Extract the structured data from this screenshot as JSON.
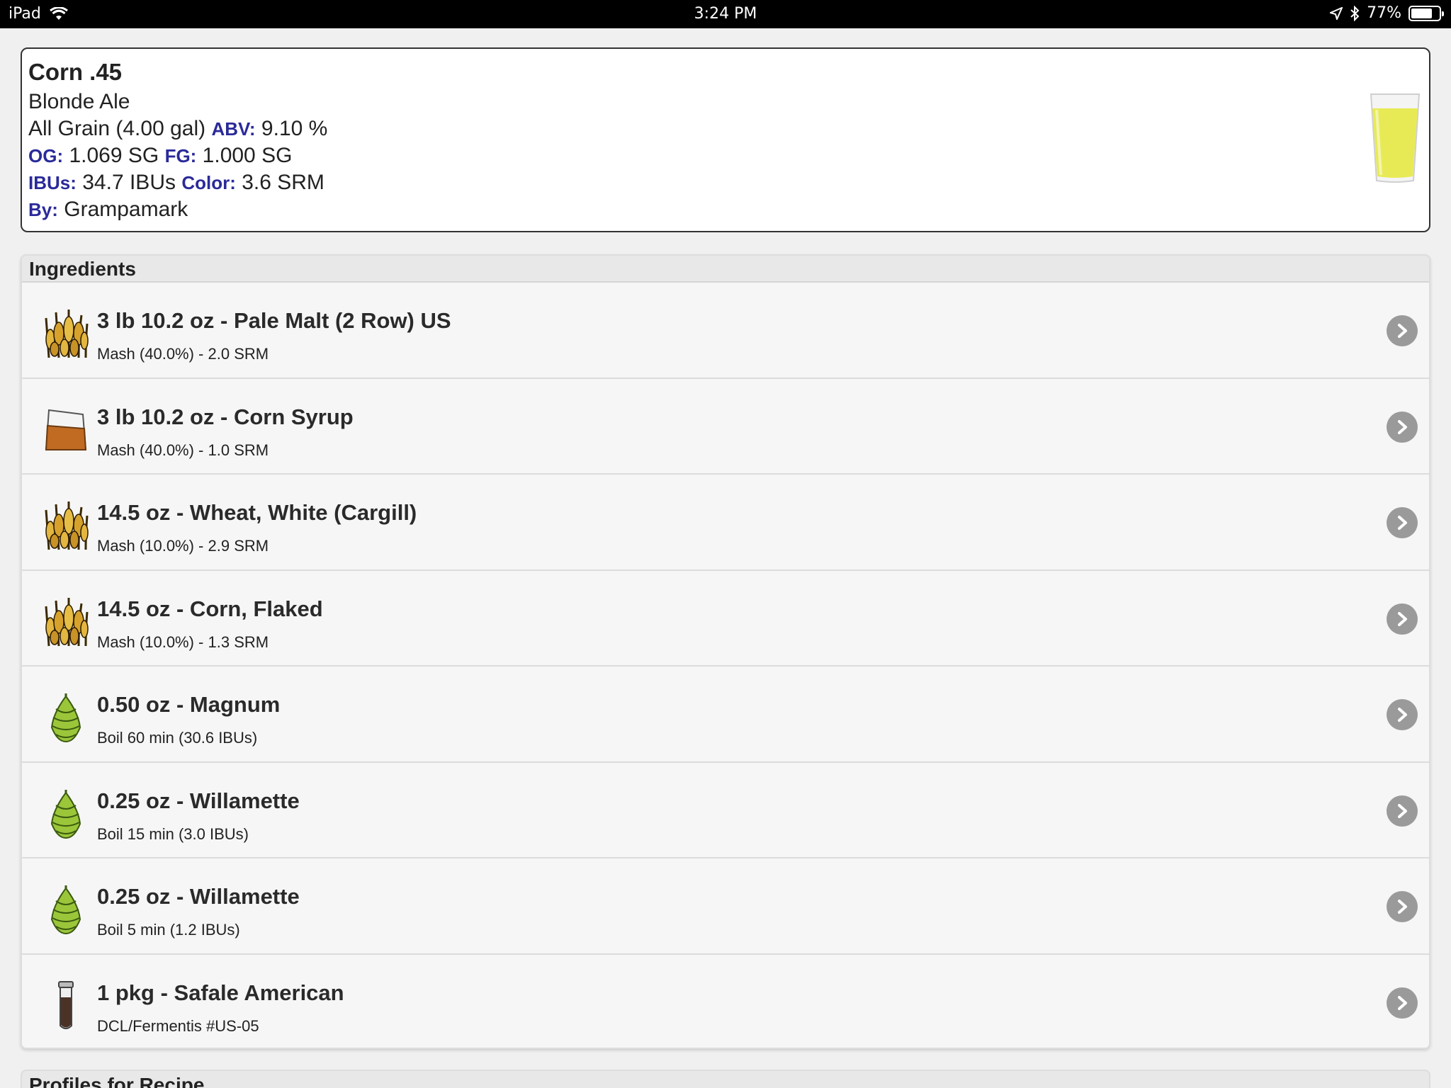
{
  "status_bar": {
    "device": "iPad",
    "time": "3:24 PM",
    "battery": "77%",
    "battery_level": 0.77
  },
  "recipe": {
    "name": "Corn .45",
    "style": "Blonde Ale",
    "type": "All Grain (4.00 gal)",
    "abv_label": "ABV:",
    "abv": "9.10 %",
    "og_label": "OG:",
    "og": "1.069 SG",
    "fg_label": "FG:",
    "fg": "1.000 SG",
    "ibus_label": "IBUs:",
    "ibus": "34.7 IBUs",
    "color_label": "Color:",
    "color": "3.6 SRM",
    "by_label": "By:",
    "by": "Grampamark",
    "glass_color": "#e8ea55"
  },
  "ingredients": {
    "header": "Ingredients",
    "items": [
      {
        "icon": "grain-icon",
        "name": "3 lb 10.2 oz - Pale Malt (2 Row) US",
        "detail": "Mash (40.0%) - 2.0 SRM"
      },
      {
        "icon": "syrup-icon",
        "name": "3 lb 10.2 oz - Corn Syrup",
        "detail": "Mash (40.0%) - 1.0 SRM"
      },
      {
        "icon": "grain-icon",
        "name": "14.5 oz - Wheat, White (Cargill)",
        "detail": "Mash (10.0%) - 2.9 SRM"
      },
      {
        "icon": "grain-icon",
        "name": "14.5 oz - Corn, Flaked",
        "detail": "Mash (10.0%) - 1.3 SRM"
      },
      {
        "icon": "hop-icon",
        "name": "0.50 oz - Magnum",
        "detail": "Boil 60 min (30.6 IBUs)"
      },
      {
        "icon": "hop-icon",
        "name": "0.25 oz - Willamette",
        "detail": "Boil 15 min (3.0 IBUs)"
      },
      {
        "icon": "hop-icon",
        "name": "0.25 oz - Willamette",
        "detail": "Boil 5 min (1.2 IBUs)"
      },
      {
        "icon": "yeast-icon",
        "name": "1 pkg - Safale American",
        "detail": "DCL/Fermentis #US-05"
      }
    ]
  },
  "profiles": {
    "header": "Profiles for Recipe"
  }
}
